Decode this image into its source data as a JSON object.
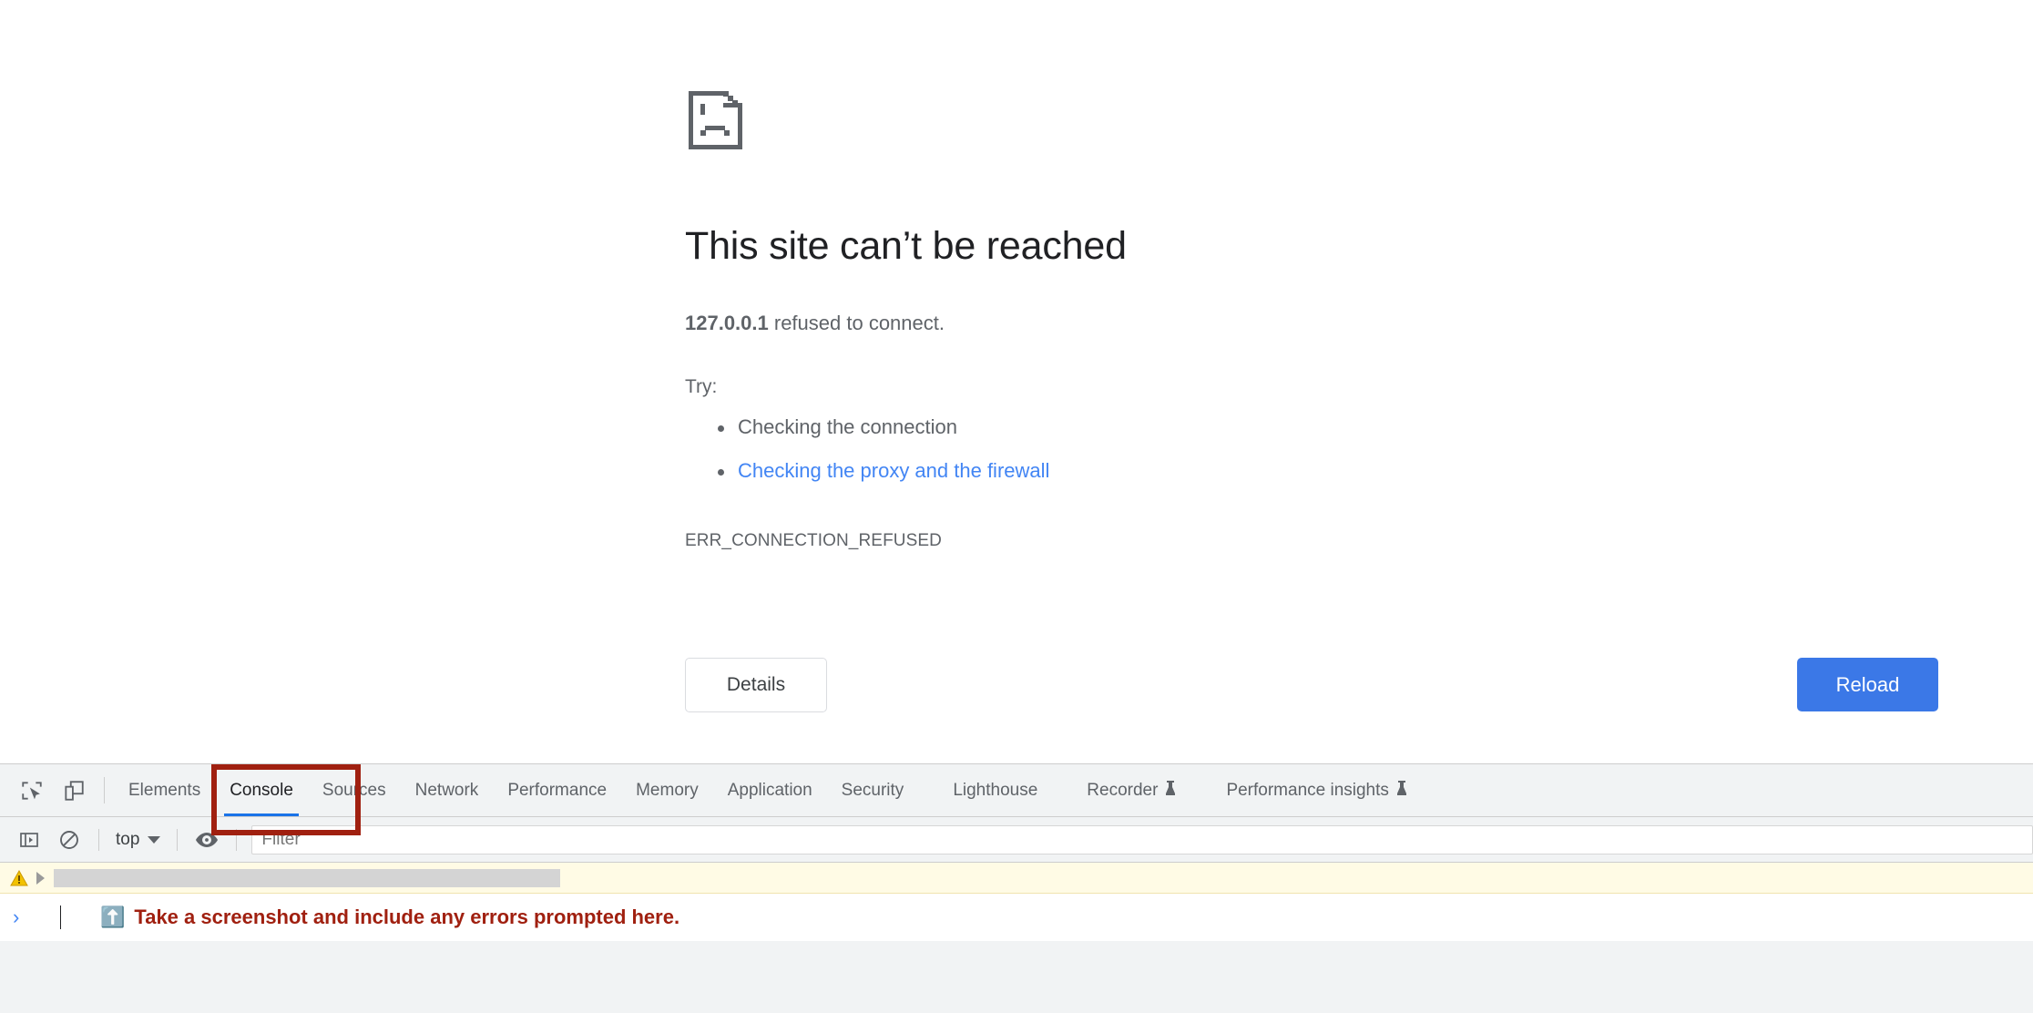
{
  "error_page": {
    "icon": "sad-page-icon",
    "title": "This site can’t be reached",
    "subtitle_host": "127.0.0.1",
    "subtitle_rest": " refused to connect.",
    "try_label": "Try:",
    "suggestions": [
      {
        "text": "Checking the connection",
        "is_link": false
      },
      {
        "text": "Checking the proxy and the firewall",
        "is_link": true
      }
    ],
    "error_code": "ERR_CONNECTION_REFUSED",
    "details_button": "Details",
    "reload_button": "Reload",
    "colors": {
      "link": "#4285f4",
      "reload_bg": "#3b78e7",
      "title": "#202124",
      "body_text": "#5f6368"
    }
  },
  "devtools": {
    "left_icons": [
      {
        "name": "inspect-element-icon",
        "title": "Inspect"
      },
      {
        "name": "device-toolbar-icon",
        "title": "Toggle device toolbar"
      }
    ],
    "tabs": [
      {
        "label": "Elements",
        "active": false,
        "experimental": false
      },
      {
        "label": "Console",
        "active": true,
        "experimental": false
      },
      {
        "label": "Sources",
        "active": false,
        "experimental": false
      },
      {
        "label": "Network",
        "active": false,
        "experimental": false
      },
      {
        "label": "Performance",
        "active": false,
        "experimental": false
      },
      {
        "label": "Memory",
        "active": false,
        "experimental": false
      },
      {
        "label": "Application",
        "active": false,
        "experimental": false
      },
      {
        "label": "Security",
        "active": false,
        "experimental": false
      },
      {
        "label": "Lighthouse",
        "active": false,
        "experimental": false
      },
      {
        "label": "Recorder",
        "active": false,
        "experimental": true
      },
      {
        "label": "Performance insights",
        "active": false,
        "experimental": true
      }
    ],
    "active_tab_underline_color": "#1a73e8",
    "console_toolbar": {
      "sidebar_toggle_icon": "console-sidebar-icon",
      "clear_console_icon": "clear-console-icon",
      "context_label": "top",
      "context_caret_icon": "chevron-down-icon",
      "live_expression_icon": "eye-icon",
      "filter_placeholder": "Filter",
      "filter_value": ""
    },
    "console_messages": [
      {
        "type": "warning",
        "icon": "warning-triangle-icon",
        "expandable": true,
        "text": "",
        "redacted": true
      }
    ],
    "prompt": {
      "arrow_icon": "console-prompt-arrow-icon",
      "value": ""
    }
  },
  "annotations": {
    "console_tab_highlight_color": "#a02010",
    "note_emoji": "⬆️",
    "note_text": "Take a screenshot and include any errors prompted here.",
    "note_color": "#a02010"
  }
}
